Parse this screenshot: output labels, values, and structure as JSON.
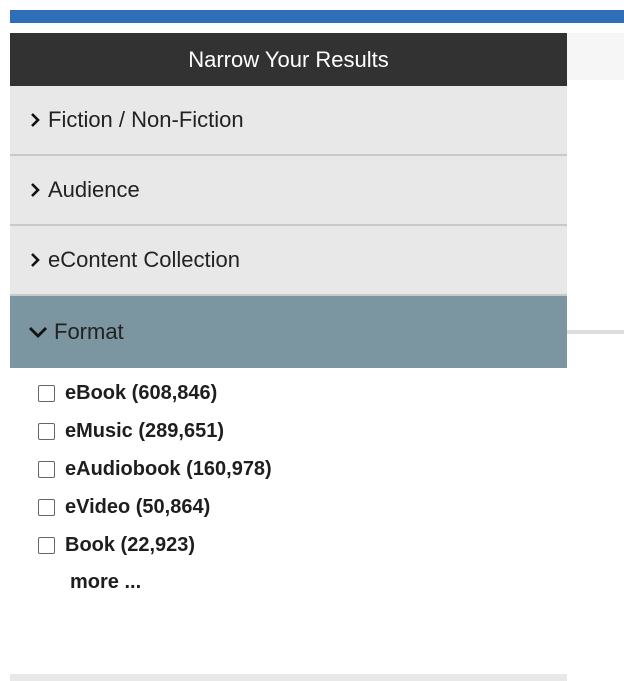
{
  "panel": {
    "title": "Narrow Your Results",
    "facets": [
      {
        "label": "Fiction / Non-Fiction",
        "expanded": false,
        "icon": "chevron-right-icon"
      },
      {
        "label": "Audience",
        "expanded": false,
        "icon": "chevron-right-icon"
      },
      {
        "label": "eContent Collection",
        "expanded": false,
        "icon": "chevron-right-icon"
      },
      {
        "label": "Format",
        "expanded": true,
        "icon": "chevron-down-icon"
      }
    ],
    "format_options": [
      {
        "label": "eBook (608,846)",
        "checked": false
      },
      {
        "label": "eMusic (289,651)",
        "checked": false
      },
      {
        "label": "eAudiobook (160,978)",
        "checked": false
      },
      {
        "label": "eVideo (50,864)",
        "checked": false
      },
      {
        "label": "Book (22,923)",
        "checked": false
      }
    ],
    "more_label": "more ..."
  },
  "colors": {
    "accent_bar": "#2e6fb7",
    "header_bg": "#323232",
    "facet_bg": "#e8e8e8",
    "facet_open_bg": "#7b96a0"
  }
}
